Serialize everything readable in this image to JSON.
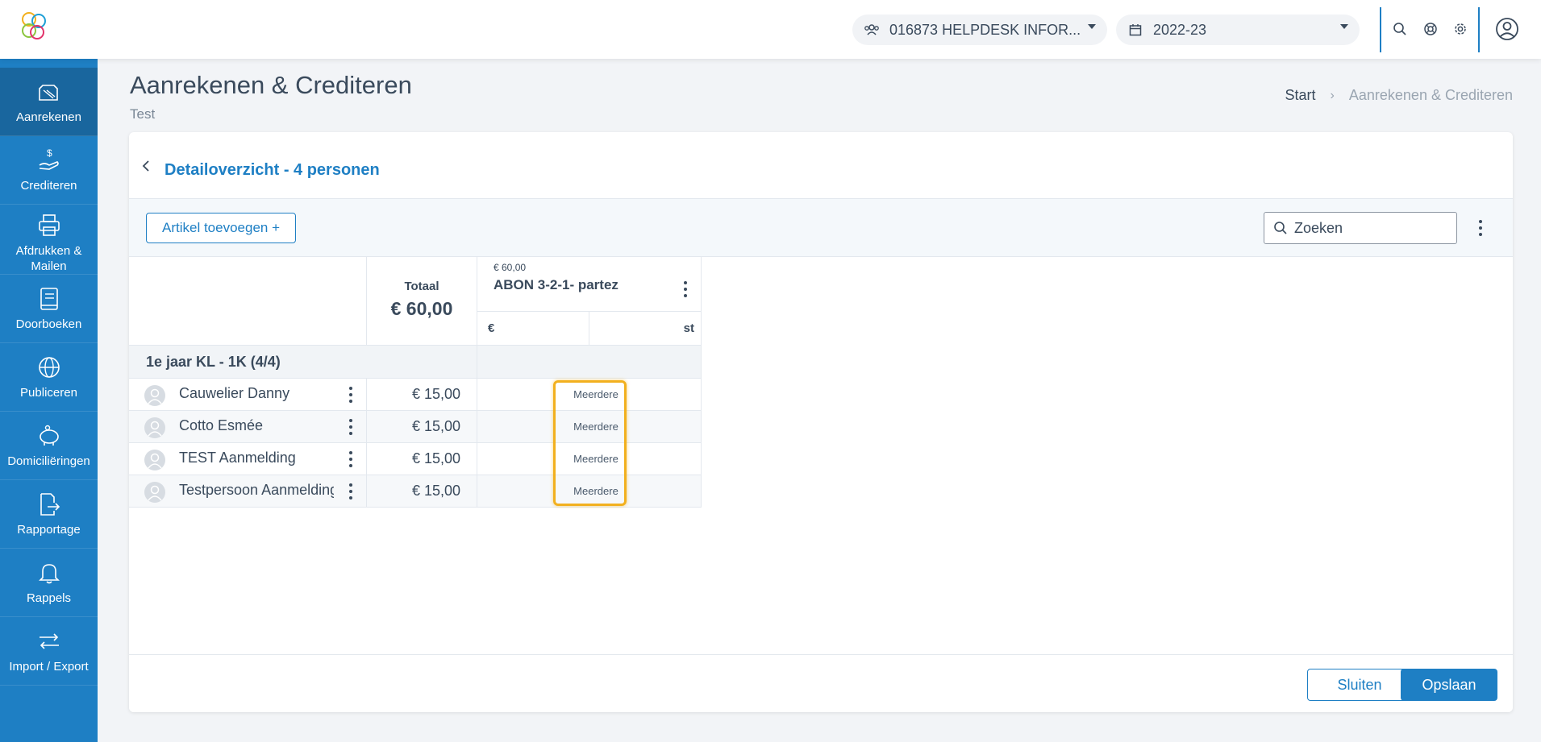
{
  "topbar": {
    "org_selector": "016873 HELPDESK INFOR...",
    "year_selector": "2022-23",
    "accent": "#1e7fc4"
  },
  "sidebar": {
    "items": [
      {
        "label": "Aanrekenen",
        "icon": "invoice-icon",
        "active": true
      },
      {
        "label": "Crediteren",
        "icon": "hand-dollar-icon"
      },
      {
        "label": "Afdrukken & Mailen",
        "icon": "printer-icon"
      },
      {
        "label": "Doorboeken",
        "icon": "ledger-book-icon"
      },
      {
        "label": "Publiceren",
        "icon": "globe-icon"
      },
      {
        "label": "Domiciliëringen",
        "icon": "piggy-bank-icon"
      },
      {
        "label": "Rapportage",
        "icon": "report-export-icon"
      },
      {
        "label": "Rappels",
        "icon": "bell-icon"
      },
      {
        "label": "Import / Export",
        "icon": "arrows-swap-icon"
      }
    ]
  },
  "header": {
    "title": "Aanrekenen & Crediteren",
    "subtitle": "Test",
    "breadcrumb": [
      "Start",
      "Aanrekenen & Crediteren"
    ]
  },
  "card": {
    "title": "Detailoverzicht - 4 personen",
    "add_article_label": "Artikel toevoegen +",
    "search_placeholder": "Zoeken",
    "total_label": "Totaal",
    "total_value": "€ 60,00",
    "article": {
      "price": "€ 60,00",
      "name": "ABON 3-2-1- partez",
      "col_currency": "€",
      "col_unit": "st"
    },
    "group": "1e jaar KL - 1K (4/4)",
    "rows": [
      {
        "name": "Cauwelier Danny",
        "amount": "€ 15,00",
        "cell": "Meerdere"
      },
      {
        "name": "Cotto Esmée",
        "amount": "€ 15,00",
        "cell": "Meerdere"
      },
      {
        "name": "TEST Aanmelding",
        "amount": "€ 15,00",
        "cell": "Meerdere"
      },
      {
        "name": "Testpersoon Aanmelding",
        "amount": "€ 15,00",
        "cell": "Meerdere"
      }
    ],
    "close_label": "Sluiten",
    "save_label": "Opslaan"
  }
}
